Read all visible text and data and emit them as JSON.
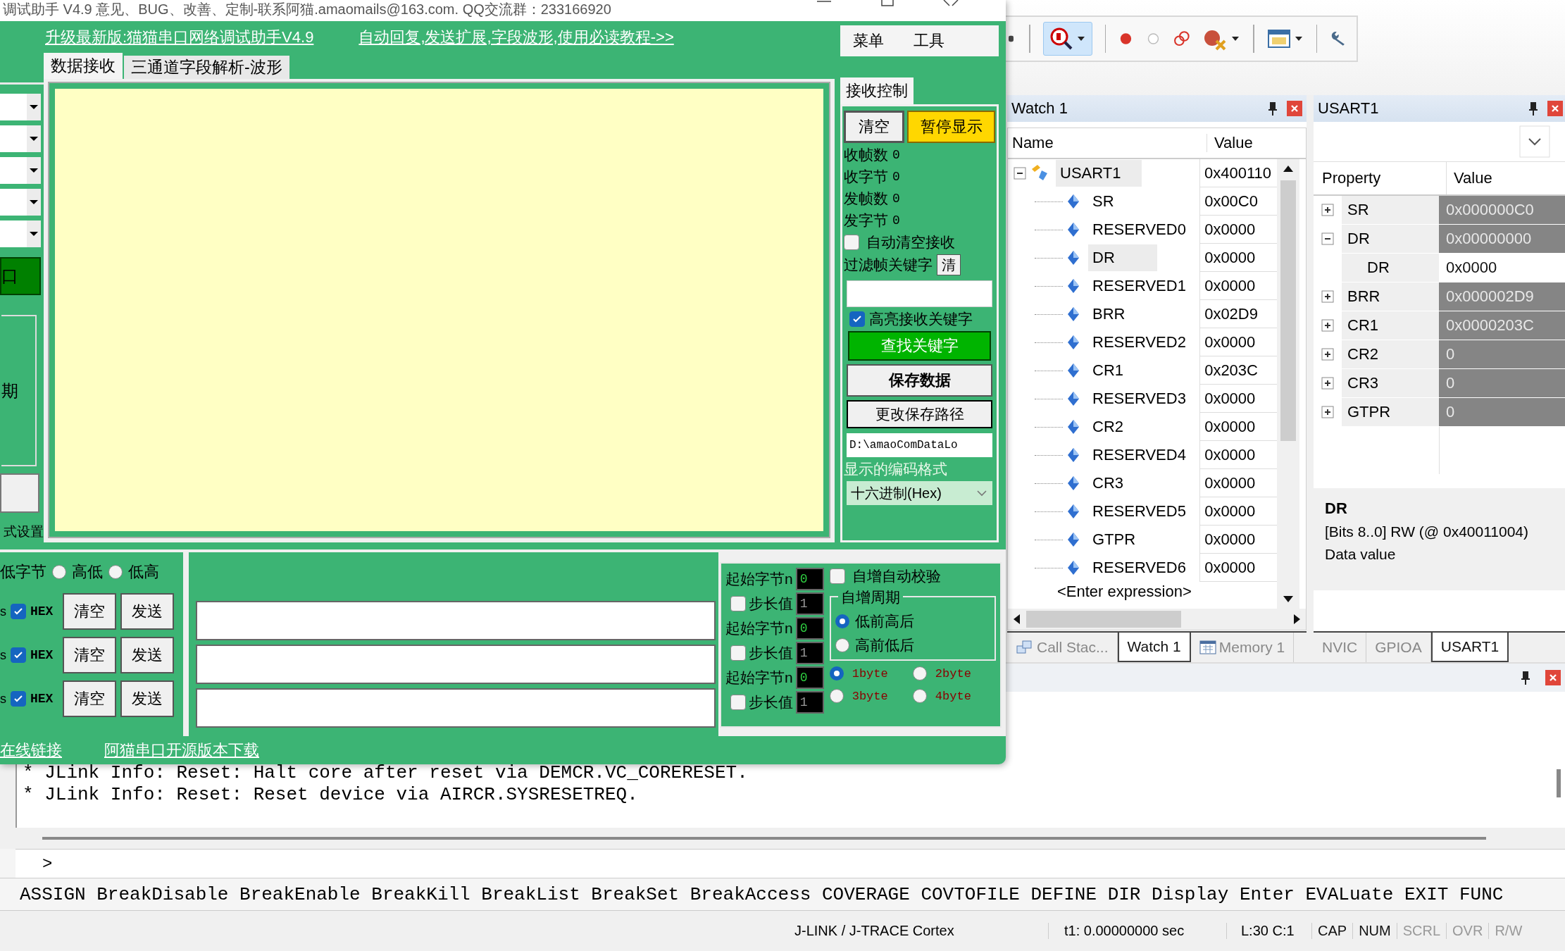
{
  "serial": {
    "title": "调试助手 V4.9 意见、BUG、改善、定制-联系阿猫.amaomails@163.com. QQ交流群：233166920",
    "links": [
      "升级最新版:猫猫串口网络调试助手V4.9",
      "自动回复,发送扩展,字段波形,使用必读教程->>"
    ],
    "menu": [
      "菜单",
      "工具"
    ],
    "tabs": [
      {
        "label": "数据接收",
        "selected": true
      },
      {
        "label": "三通道字段解析-波形",
        "selected": false
      }
    ],
    "left_panel": {
      "open_button": "口",
      "group_label": "期",
      "section_label": "式设置"
    },
    "receive_control": {
      "tab": "接收控制",
      "clear_button": "清空",
      "pause_button": "暂停显示",
      "counters": [
        {
          "label": "收帧数",
          "value": "0"
        },
        {
          "label": "收字节",
          "value": "0"
        },
        {
          "label": "发帧数",
          "value": "0"
        },
        {
          "label": "发字节",
          "value": "0"
        }
      ],
      "auto_clear": {
        "label": "自动清空接收",
        "checked": false
      },
      "filter_label": "过滤帧关键字",
      "filter_clear": "清",
      "highlight": {
        "label": "高亮接收关键字",
        "checked": true
      },
      "find_button": "查找关键字",
      "save_button": "保存数据",
      "path_button": "更改保存路径",
      "path": "D:\\amaoComDataLo",
      "encoding_label": "显示的编码格式",
      "encoding": "十六进制(Hex)"
    },
    "byte_order": {
      "label": "低字节",
      "options": [
        {
          "label": "高低",
          "selected": false
        },
        {
          "label": "低高",
          "selected": false
        }
      ]
    },
    "send_rows": [
      {
        "prefix": "s",
        "hex": {
          "label": "HEX",
          "checked": true
        },
        "clear": "清空",
        "send": "发送"
      },
      {
        "prefix": "s",
        "hex": {
          "label": "HEX",
          "checked": true
        },
        "clear": "清空",
        "send": "发送"
      },
      {
        "prefix": "s",
        "hex": {
          "label": "HEX",
          "checked": true
        },
        "clear": "清空",
        "send": "发送"
      }
    ],
    "increment": {
      "rows": [
        {
          "start_label": "起始字节n",
          "start": "0",
          "step_label": "步长值",
          "step": "1",
          "checked": false
        },
        {
          "start_label": "起始字节n",
          "start": "0",
          "step_label": "步长值",
          "step": "1",
          "checked": false
        },
        {
          "start_label": "起始字节n",
          "start": "0",
          "step_label": "步长值",
          "step": "1",
          "checked": false
        }
      ],
      "auto_check": {
        "label": "自增自动校验",
        "checked": false
      },
      "period_label": "自增周期",
      "period_options": [
        {
          "label": "低前高后",
          "selected": true
        },
        {
          "label": "高前低后",
          "selected": false
        }
      ],
      "sizes": [
        {
          "label": "1byte",
          "selected": true
        },
        {
          "label": "2byte",
          "selected": false
        },
        {
          "label": "3byte",
          "selected": false
        },
        {
          "label": "4byte",
          "selected": false
        }
      ]
    },
    "footer_links": [
      "在线链接",
      "阿猫串口开源版本下载"
    ]
  },
  "ide": {
    "watch": {
      "title": "Watch 1",
      "columns": [
        "Name",
        "Value"
      ],
      "root": {
        "name": "USART1",
        "value": "0x400110",
        "expanded": true,
        "children": [
          {
            "name": "SR",
            "value": "0x00C0",
            "selected": false
          },
          {
            "name": "RESERVED0",
            "value": "0x0000",
            "selected": false
          },
          {
            "name": "DR",
            "value": "0x0000",
            "selected": true
          },
          {
            "name": "RESERVED1",
            "value": "0x0000",
            "selected": false
          },
          {
            "name": "BRR",
            "value": "0x02D9",
            "selected": false
          },
          {
            "name": "RESERVED2",
            "value": "0x0000",
            "selected": false
          },
          {
            "name": "CR1",
            "value": "0x203C",
            "selected": false
          },
          {
            "name": "RESERVED3",
            "value": "0x0000",
            "selected": false
          },
          {
            "name": "CR2",
            "value": "0x0000",
            "selected": false
          },
          {
            "name": "RESERVED4",
            "value": "0x0000",
            "selected": false
          },
          {
            "name": "CR3",
            "value": "0x0000",
            "selected": false
          },
          {
            "name": "RESERVED5",
            "value": "0x0000",
            "selected": false
          },
          {
            "name": "GTPR",
            "value": "0x0000",
            "selected": false
          },
          {
            "name": "RESERVED6",
            "value": "0x0000",
            "selected": false
          }
        ]
      },
      "enter_row": "<Enter expression>",
      "tabs": [
        {
          "label": "Call Stac...",
          "selected": false
        },
        {
          "label": "Watch 1",
          "selected": true
        },
        {
          "label": "Memory 1",
          "selected": false
        }
      ]
    },
    "peripheral": {
      "title": "USART1",
      "columns": [
        "Property",
        "Value"
      ],
      "properties": [
        {
          "name": "SR",
          "value": "0x000000C0",
          "expanded": false
        },
        {
          "name": "DR",
          "value": "0x00000000",
          "expanded": true,
          "children": [
            {
              "name": "DR",
              "value": "0x0000"
            }
          ]
        },
        {
          "name": "BRR",
          "value": "0x000002D9",
          "expanded": false
        },
        {
          "name": "CR1",
          "value": "0x0000203C",
          "expanded": false
        },
        {
          "name": "CR2",
          "value": "0",
          "expanded": false
        },
        {
          "name": "CR3",
          "value": "0",
          "expanded": false
        },
        {
          "name": "GTPR",
          "value": "0",
          "expanded": false
        }
      ],
      "description": {
        "name": "DR",
        "bits": "[Bits 8..0] RW (@ 0x40011004)",
        "text": "Data value"
      },
      "tabs": [
        {
          "label": "NVIC",
          "selected": false
        },
        {
          "label": "GPIOA",
          "selected": false
        },
        {
          "label": "USART1",
          "selected": true
        }
      ]
    },
    "output": [
      "* JLink Info: Reset: Halt core after reset via DEMCR.VC_CORERESET.",
      "* JLink Info: Reset: Reset device via AIRCR.SYSRESETREQ."
    ],
    "prompt": ">",
    "commands": "ASSIGN BreakDisable BreakEnable BreakKill BreakList BreakSet BreakAccess COVERAGE COVTOFILE DEFINE DIR Display Enter EVALuate EXIT FUNC",
    "status": {
      "target": "J-LINK / J-TRACE Cortex",
      "time": "t1: 0.00000000 sec",
      "position": "L:30 C:1",
      "indicators": [
        {
          "label": "CAP",
          "on": true
        },
        {
          "label": "NUM",
          "on": true
        },
        {
          "label": "SCRL",
          "on": false
        },
        {
          "label": "OVR",
          "on": false
        },
        {
          "label": "R/W",
          "on": false
        }
      ]
    }
  }
}
